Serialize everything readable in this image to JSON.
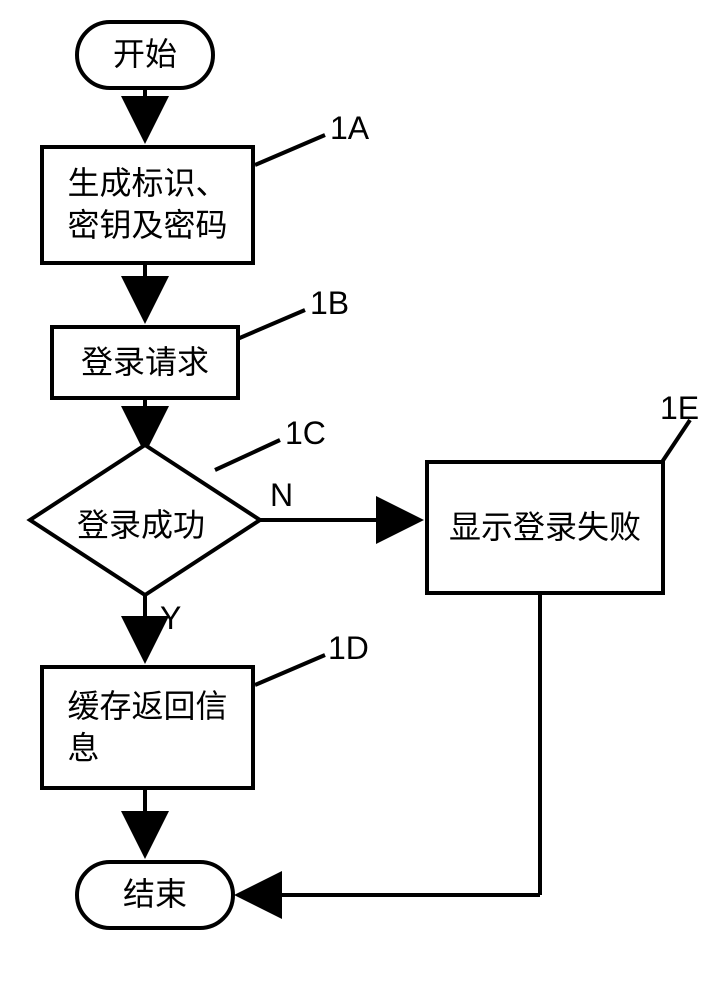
{
  "nodes": {
    "start": "开始",
    "step_1A": "生成标识、\n密钥及密码",
    "step_1B": "登录请求",
    "decision_1C": "登录成功",
    "step_1D": "缓存返回信\n息",
    "step_1E": "显示登录失败",
    "end": "结束"
  },
  "labels": {
    "l1A": "1A",
    "l1B": "1B",
    "l1C": "1C",
    "l1D": "1D",
    "l1E": "1E",
    "yes": "Y",
    "no": "N"
  },
  "chart_data": {
    "type": "flowchart",
    "title": "",
    "nodes": [
      {
        "id": "start",
        "type": "terminal",
        "text": "开始"
      },
      {
        "id": "1A",
        "type": "process",
        "text": "生成标识、密钥及密码"
      },
      {
        "id": "1B",
        "type": "process",
        "text": "登录请求"
      },
      {
        "id": "1C",
        "type": "decision",
        "text": "登录成功"
      },
      {
        "id": "1D",
        "type": "process",
        "text": "缓存返回信息"
      },
      {
        "id": "1E",
        "type": "process",
        "text": "显示登录失败"
      },
      {
        "id": "end",
        "type": "terminal",
        "text": "结束"
      }
    ],
    "edges": [
      {
        "from": "start",
        "to": "1A"
      },
      {
        "from": "1A",
        "to": "1B"
      },
      {
        "from": "1B",
        "to": "1C"
      },
      {
        "from": "1C",
        "to": "1D",
        "label": "Y"
      },
      {
        "from": "1C",
        "to": "1E",
        "label": "N"
      },
      {
        "from": "1D",
        "to": "end"
      },
      {
        "from": "1E",
        "to": "end"
      }
    ]
  }
}
